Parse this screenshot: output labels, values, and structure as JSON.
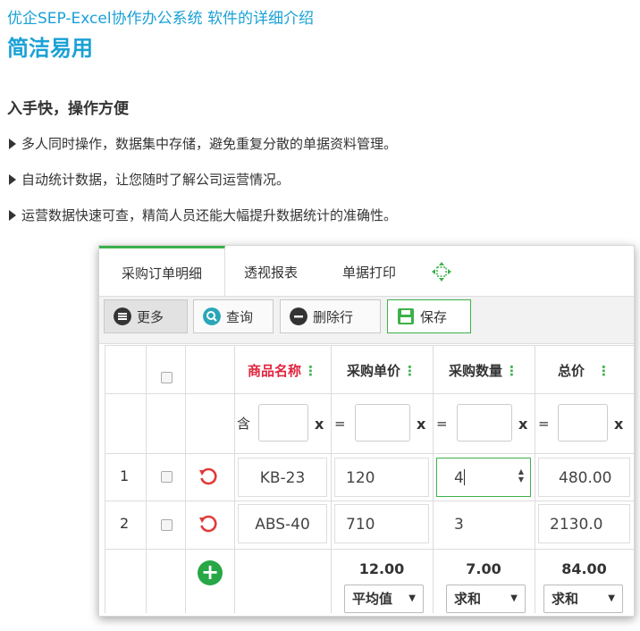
{
  "header": {
    "top_title": "优企SEP-Excel协作办公系统 软件的详细介绍",
    "big_title": "简洁易用",
    "section_heading": "入手快，操作方便"
  },
  "bullets": [
    "多人同时操作，数据集中存储，避免重复分散的单据资料管理。",
    "自动统计数据，让您随时了解公司运营情况。",
    "运营数据快速可查，精简人员还能大幅提升数据统计的准确性。"
  ],
  "tabs": [
    "采购订单明细",
    "透视报表",
    "单据打印"
  ],
  "toolbar": {
    "more": "更多",
    "query": "查询",
    "delete_row": "删除行",
    "save": "保存"
  },
  "columns": {
    "name": "商品名称",
    "unit_price": "采购单价",
    "quantity": "采购数量",
    "total": "总价",
    "menu_glyph": "⋮"
  },
  "filters": {
    "contains": "含",
    "clear": "x",
    "equals": "="
  },
  "rows": [
    {
      "index": "1",
      "name": "KB-23",
      "unit_price": "120",
      "quantity": "4",
      "total": "480.00"
    },
    {
      "index": "2",
      "name": "ABS-40",
      "unit_price": "710",
      "quantity": "3",
      "total": "2130.0"
    }
  ],
  "summary": {
    "add_glyph": "+",
    "unit_price": {
      "value": "12.00",
      "func": "平均值"
    },
    "quantity": {
      "value": "7.00",
      "func": "求和"
    },
    "total": {
      "value": "84.00",
      "func": "求和"
    }
  },
  "colors": {
    "brand_blue": "#1aa1d6",
    "accent_green": "#3db14a",
    "header_red": "#e0253e",
    "undo_red": "#e23a3a"
  }
}
